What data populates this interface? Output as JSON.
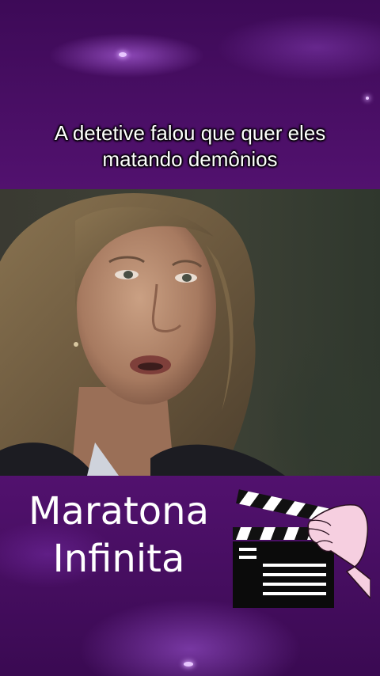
{
  "caption": {
    "line1": "A detetive falou que quer eles",
    "line2": "matando demônios"
  },
  "brand": {
    "line1": "Maratona",
    "line2": "Infinita"
  },
  "icons": {
    "logo_icon": "clapperboard-hand-icon"
  },
  "colors": {
    "background": "#4a0f66",
    "text": "#ffffff"
  }
}
